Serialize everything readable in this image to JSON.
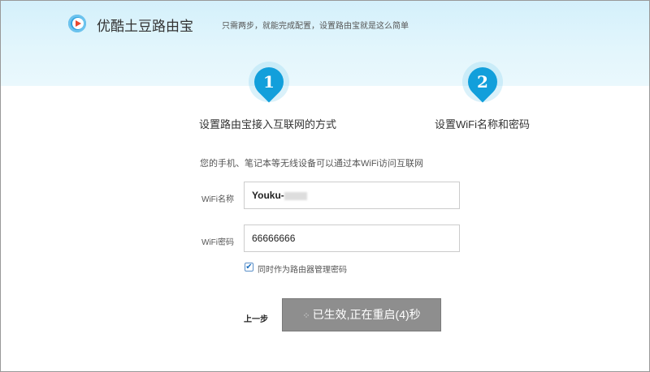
{
  "header": {
    "brand": "优酷土豆路由宝",
    "slogan": "只需两步，就能完成配置，设置路由宝就是这么简单"
  },
  "steps": [
    {
      "number": "1",
      "label": "设置路由宝接入互联网的方式"
    },
    {
      "number": "2",
      "label": "设置WiFi名称和密码"
    }
  ],
  "form": {
    "description": "您的手机、笔记本等无线设备可以通过本WiFi访问互联网",
    "wifi_name_label": "WiFi名称",
    "wifi_name_value": "Youku-",
    "wifi_password_label": "WiFi密码",
    "wifi_password_value": "66666666",
    "checkbox_label": "同时作为路由器管理密码",
    "checkbox_checked": true,
    "prev_label": "上一步",
    "submit_label": "已生效,正在重启(4)秒"
  },
  "colors": {
    "accent": "#129fdb",
    "button_disabled": "#8e8e8e"
  }
}
